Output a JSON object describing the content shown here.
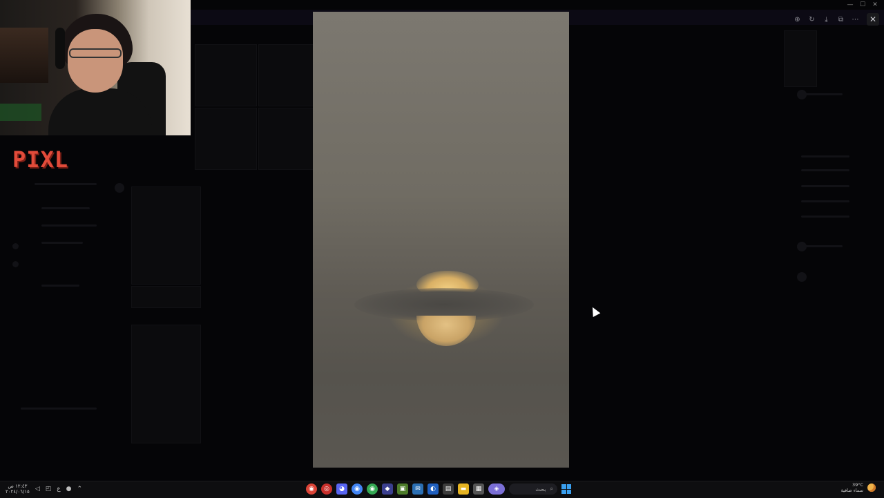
{
  "background_app": {
    "note_visible": false
  },
  "overlay": {
    "logo_text": "PIXL"
  },
  "viewer": {
    "toolbar": {
      "zoom_icon": "zoom-in-icon",
      "rotate_icon": "rotate-icon",
      "download_icon": "download-icon",
      "open_external_icon": "open-external-icon",
      "more_icon": "more-icon",
      "close_icon": "close-icon"
    }
  },
  "taskbar": {
    "clock_time": "١٢:٤٣ ص",
    "clock_date": "٢٠٢٤/٠٦/١٥",
    "search_placeholder": "بحث",
    "weather_temp": "39°C",
    "weather_desc": "سماء صافية"
  },
  "colors": {
    "logo": "#e14b3a",
    "start": "#3aa0f0",
    "taskbar_bg": "#0e0e10"
  }
}
